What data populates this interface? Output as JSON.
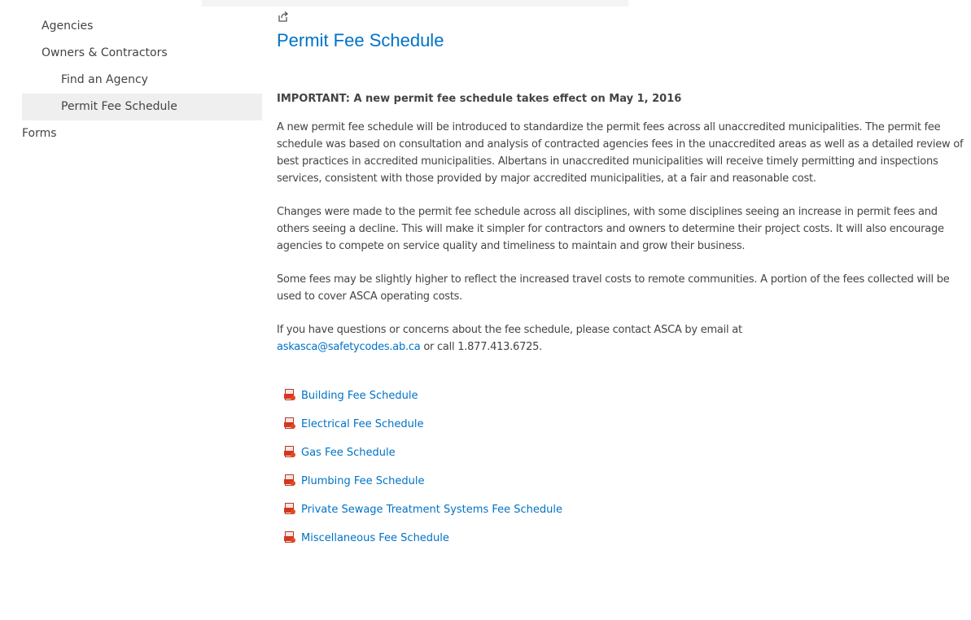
{
  "sidebar": {
    "items": [
      {
        "label": "Agencies"
      },
      {
        "label": "Owners & Contractors"
      },
      {
        "label": "Find an Agency"
      },
      {
        "label": "Permit Fee Schedule"
      },
      {
        "label": "Forms"
      }
    ]
  },
  "main": {
    "share_icon": "share-icon",
    "title": "Permit Fee Schedule",
    "important": "IMPORTANT: A new permit fee schedule takes effect on May 1, 2016",
    "paragraphs": [
      "A new permit fee schedule will be introduced to standardize the permit fees across all unaccredited municipalities. The permit fee schedule was based on consultation and analysis of contracted agencies fees in the unaccredited areas as well as a detailed review of best practices in accredited municipalities. Albertans in unaccredited municipalities will receive timely permitting and inspections services, consistent with those provided by major accredited municipalities, at a fair and reasonable cost.",
      "Changes were made to the permit fee schedule across all disciplines, with some disciplines seeing an increase in permit fees and others seeing a decline. This will make it simpler for contractors and owners to determine their project costs. It will also encourage agencies to compete on service quality and timeliness to maintain and grow their business.",
      "Some fees may be slightly higher to reflect the increased travel costs to remote communities. A portion of the fees collected will be used to cover ASCA operating costs."
    ],
    "contact": {
      "lead": "If you have questions or concerns about the fee schedule, please contact ASCA by email at",
      "email": "askasca@safetycodes.ab.ca",
      "tail": " or call 1.877.413.6725."
    },
    "documents": [
      {
        "label": "Building Fee Schedule",
        "icon": "pdf-icon"
      },
      {
        "label": "Electrical Fee Schedule",
        "icon": "pdf-icon"
      },
      {
        "label": "Gas Fee Schedule",
        "icon": "pdf-icon"
      },
      {
        "label": "Plumbing Fee Schedule",
        "icon": "pdf-icon"
      },
      {
        "label": "Private Sewage Treatment Systems Fee Schedule",
        "icon": "pdf-icon"
      },
      {
        "label": "Miscellaneous Fee Schedule",
        "icon": "pdf-icon"
      }
    ]
  },
  "colors": {
    "link": "#0072c6",
    "text": "#444444",
    "selected_bg": "#efefef",
    "pdf_red": "#d6361e"
  }
}
